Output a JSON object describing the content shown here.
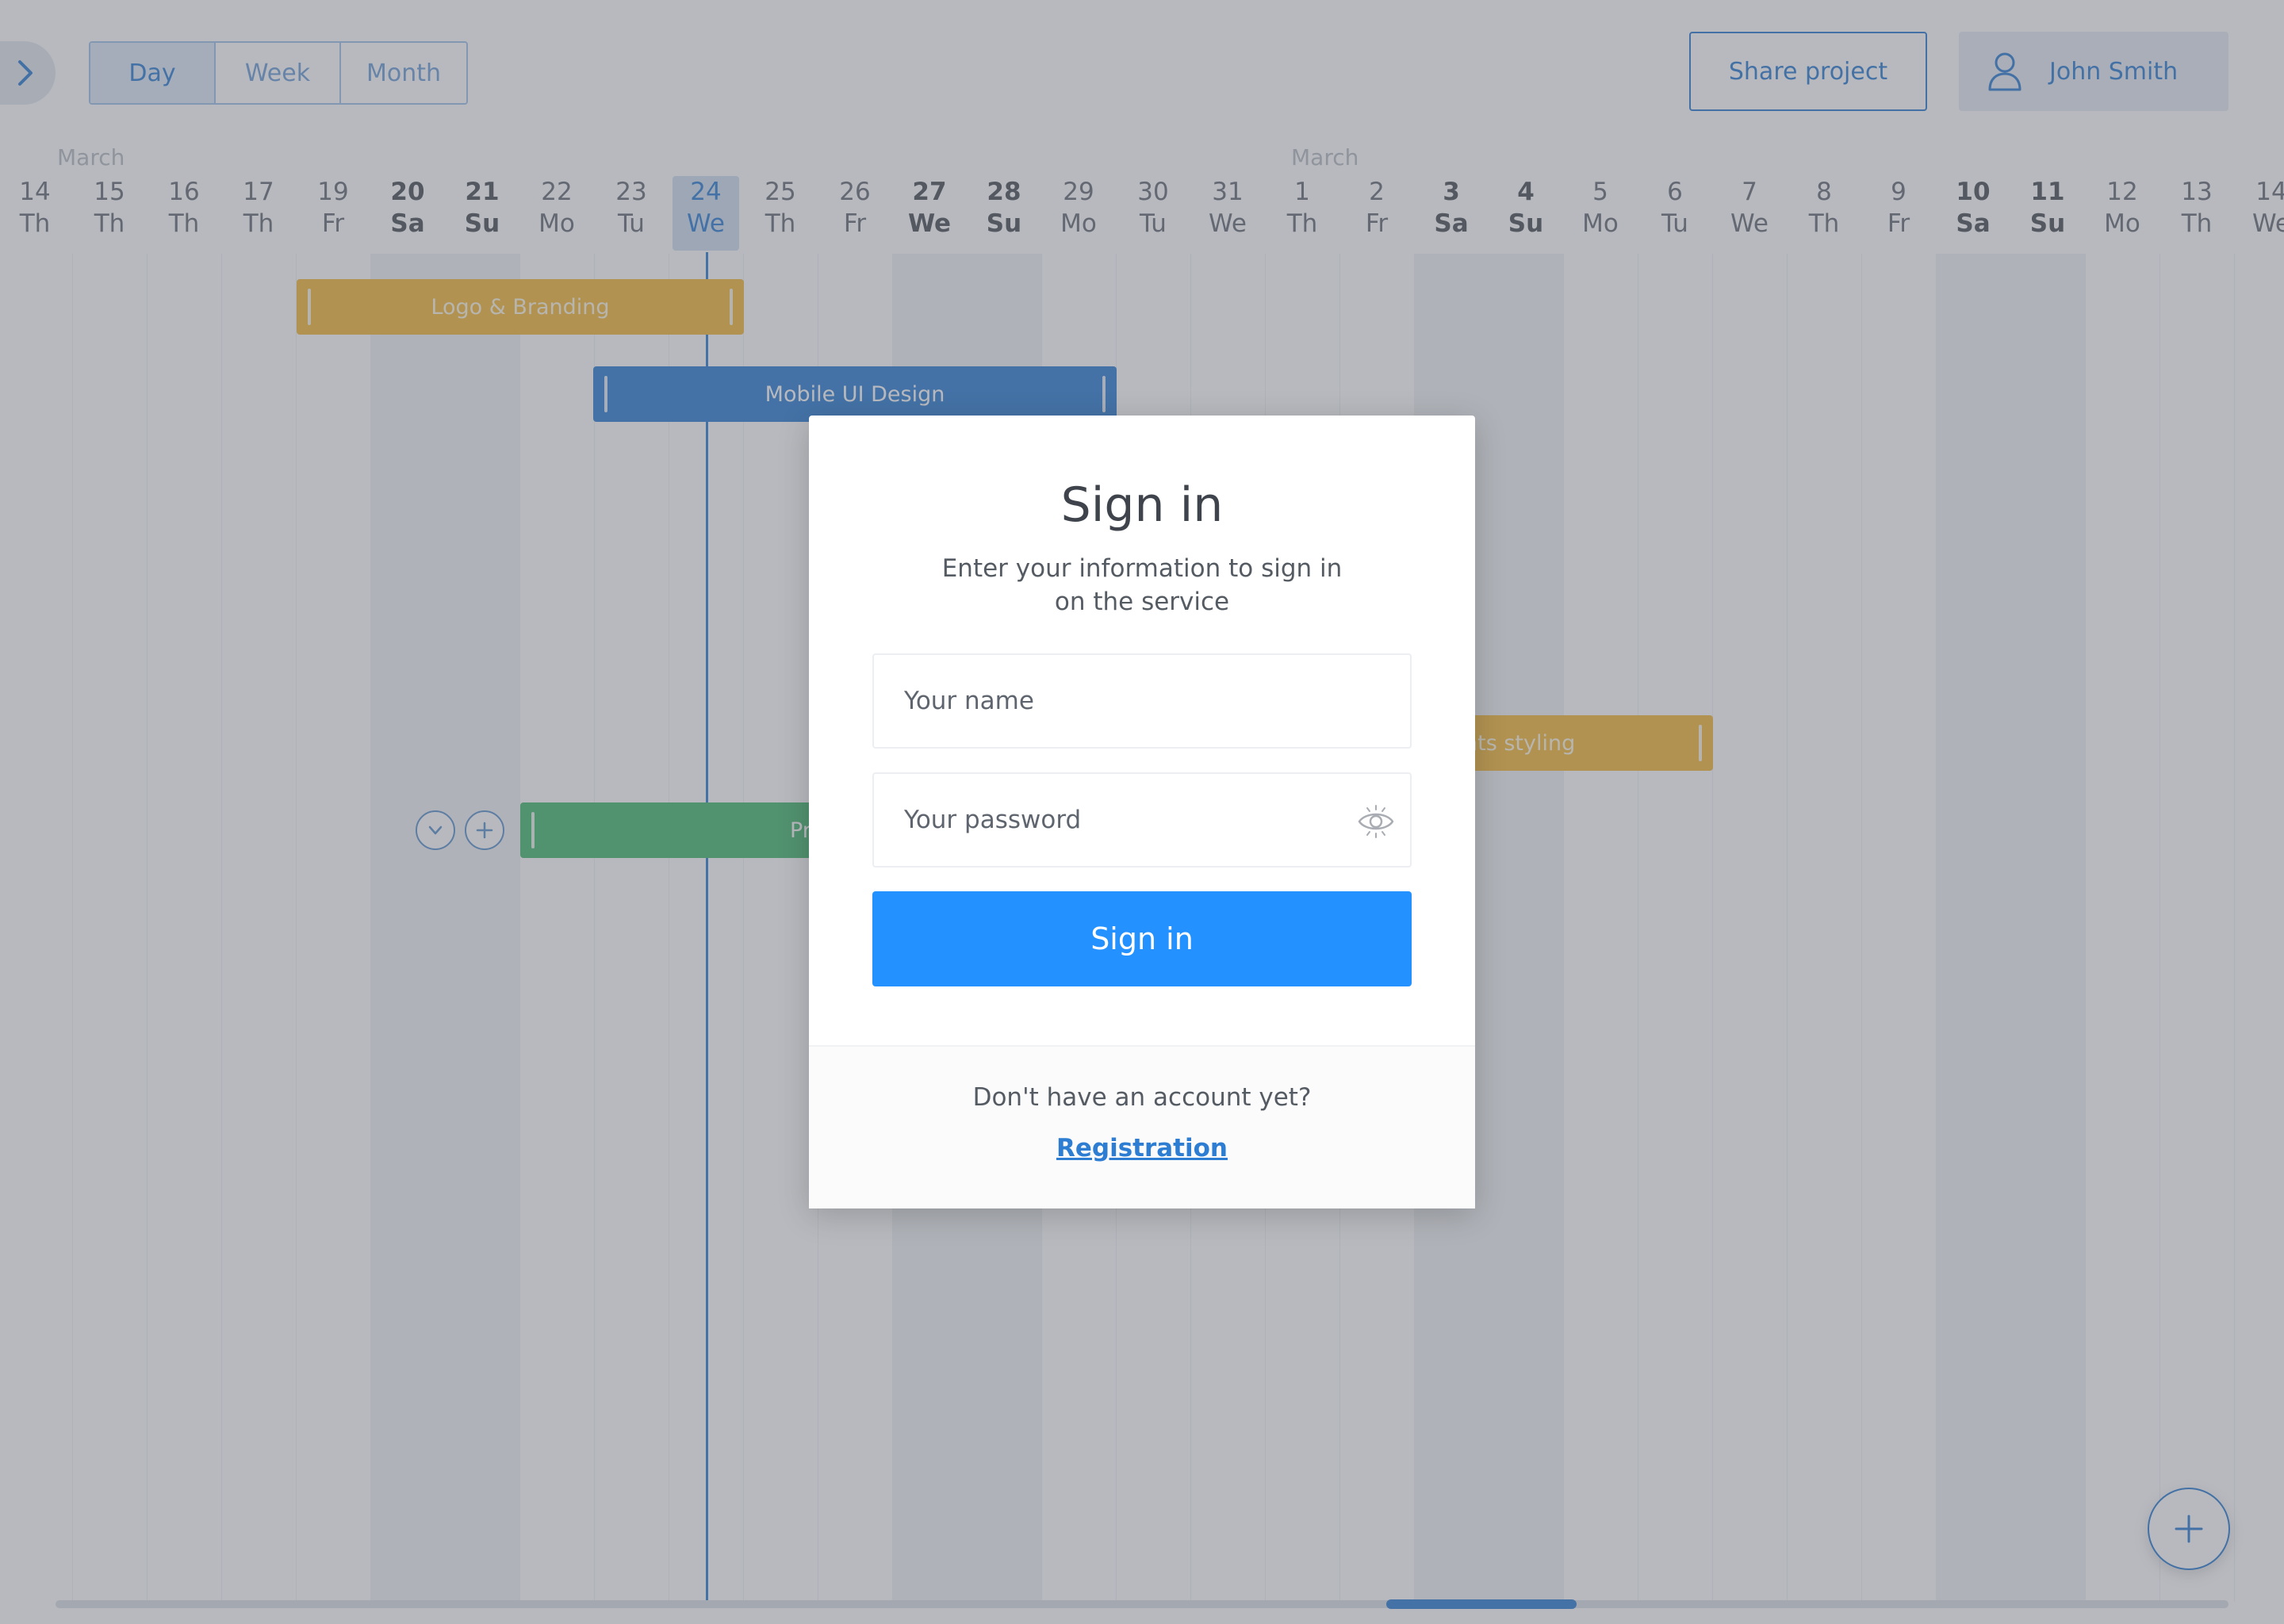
{
  "toolbar": {
    "views": [
      {
        "label": "Day",
        "active": true
      },
      {
        "label": "Week",
        "active": false
      },
      {
        "label": "Month",
        "active": false
      }
    ],
    "share_label": "Share project",
    "user_name": "John Smith"
  },
  "timeline": {
    "months": [
      "March",
      "March"
    ],
    "days": [
      {
        "num": "14",
        "wd": "Th"
      },
      {
        "num": "15",
        "wd": "Th"
      },
      {
        "num": "16",
        "wd": "Th"
      },
      {
        "num": "17",
        "wd": "Th"
      },
      {
        "num": "19",
        "wd": "Fr"
      },
      {
        "num": "20",
        "wd": "Sa",
        "bold": true
      },
      {
        "num": "21",
        "wd": "Su",
        "bold": true
      },
      {
        "num": "22",
        "wd": "Mo"
      },
      {
        "num": "23",
        "wd": "Tu"
      },
      {
        "num": "24",
        "wd": "We",
        "today": true
      },
      {
        "num": "25",
        "wd": "Th"
      },
      {
        "num": "26",
        "wd": "Fr"
      },
      {
        "num": "27",
        "wd": "We",
        "bold": true
      },
      {
        "num": "28",
        "wd": "Su",
        "bold": true
      },
      {
        "num": "29",
        "wd": "Mo"
      },
      {
        "num": "30",
        "wd": "Tu"
      },
      {
        "num": "31",
        "wd": "We"
      },
      {
        "num": "1",
        "wd": "Th"
      },
      {
        "num": "2",
        "wd": "Fr"
      },
      {
        "num": "3",
        "wd": "Sa",
        "bold": true
      },
      {
        "num": "4",
        "wd": "Su",
        "bold": true
      },
      {
        "num": "5",
        "wd": "Mo"
      },
      {
        "num": "6",
        "wd": "Tu"
      },
      {
        "num": "7",
        "wd": "We"
      },
      {
        "num": "8",
        "wd": "Th"
      },
      {
        "num": "9",
        "wd": "Fr"
      },
      {
        "num": "10",
        "wd": "Sa",
        "bold": true
      },
      {
        "num": "11",
        "wd": "Su",
        "bold": true
      },
      {
        "num": "12",
        "wd": "Mo"
      },
      {
        "num": "13",
        "wd": "Th"
      },
      {
        "num": "14",
        "wd": "We"
      }
    ]
  },
  "tasks": {
    "logo": "Logo & Branding",
    "mobile": "Mobile UI Design",
    "components": "nts styling",
    "prototype": "Pr"
  },
  "signin": {
    "title": "Sign in",
    "subtitle_line1": "Enter your information to sign in",
    "subtitle_line2": "on the service",
    "name_placeholder": "Your name",
    "password_placeholder": "Your password",
    "button_label": "Sign in",
    "no_account": "Don't have an account yet?",
    "register_link": "Registration"
  },
  "colors": {
    "accent": "#2391ff",
    "brand_blue": "#2d7dd2",
    "task_orange": "#f5b83a",
    "task_green": "#45b86f"
  }
}
